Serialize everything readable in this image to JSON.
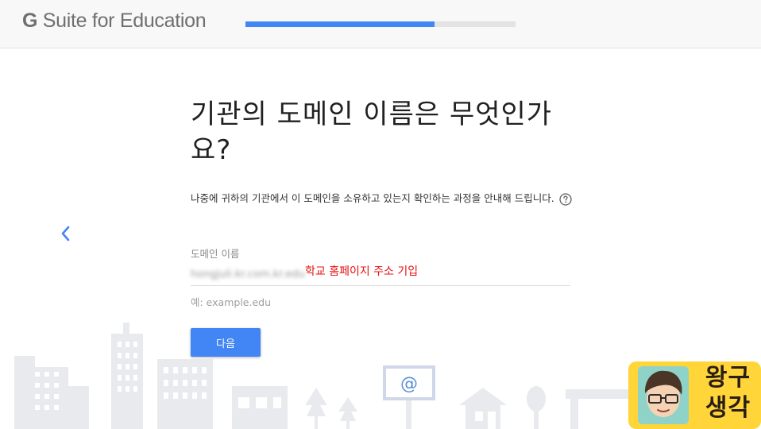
{
  "header": {
    "brand_g": "G",
    "brand_rest": " Suite for Education",
    "progress": 0.7
  },
  "main": {
    "title": "기관의 도메인 이름은 무엇인가요?",
    "description": "나중에 귀하의 기관에서 이 도메인을 소유하고 있는지 확인하는 과정을 안내해 드립니다.",
    "domain_field": {
      "label": "도메인 이름",
      "value": "hongjuli.kr.com.kr.edu",
      "example": "예: example.edu"
    },
    "annotation": "학교 홈페이지 주소 기입",
    "next_button": "다음"
  },
  "icons": {
    "back": "chevron-left-icon",
    "help": "help-circle-icon"
  },
  "billboard": {
    "symbol": "@"
  },
  "watermark": {
    "line1": "왕구",
    "line2": "생각"
  },
  "colors": {
    "accent": "#4285f4",
    "annotation": "#e81010",
    "watermark_bg": "#ffd53a",
    "skyline": "#e8eaed"
  }
}
